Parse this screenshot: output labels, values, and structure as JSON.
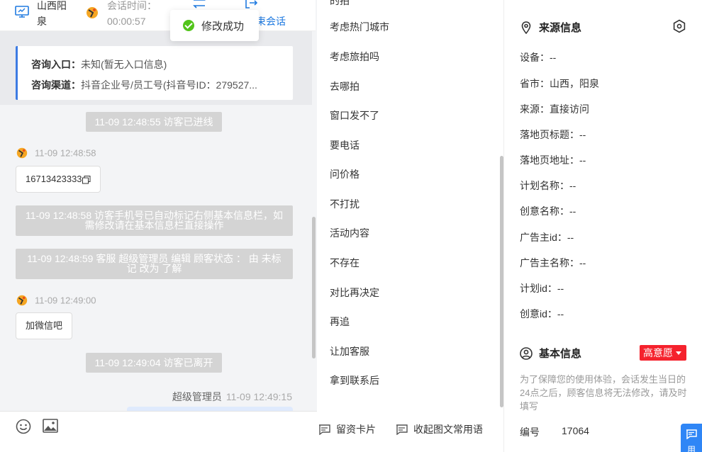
{
  "header": {
    "location": "山西阳泉",
    "session_time_label": "会话时间：",
    "session_time_value": "00:00:57",
    "end_session": "束会话"
  },
  "toast": {
    "message": "修改成功"
  },
  "info_card": {
    "entry_label": "咨询入口：",
    "entry_value": "未知(暂无入口信息)",
    "channel_label": "咨询渠道：",
    "channel_value": "抖音企业号/员工号(抖音号ID：279527..."
  },
  "messages": {
    "sys1": "11-09 12:48:55 访客已进线",
    "visitor1_time": "11-09 12:48:58",
    "visitor1_text": "16713423333",
    "sys2": "11-09 12:48:58 访客手机号已自动标记右侧基本信息栏，如需修改请在基本信息栏直接操作",
    "sys3": "11-09 12:48:59 客服 超级管理员 编辑 顾客状态 ： 由 未标记 改为 了解",
    "visitor2_time": "11-09 12:49:00",
    "visitor2_text": "加微信吧",
    "sys4": "11-09 12:49:04 访客已离开",
    "agent_name": "超级管理员",
    "agent_time": "11-09 12:49:15"
  },
  "quick_replies": {
    "items": [
      "考虑热门城市",
      "考虑旅拍吗",
      "去哪拍",
      "窗口发不了",
      "要电话",
      "问价格",
      "不打扰",
      "活动内容",
      "不存在",
      "对比再决定",
      "再追",
      "让加客服",
      "拿到联系后"
    ],
    "footer_card": "留资卡片",
    "footer_collapse": "收起图文常用语"
  },
  "source_info": {
    "title": "来源信息",
    "device": "设备：--",
    "province": "省市：山西，阳泉",
    "source": "来源：直接访问",
    "landing_title": "落地页标题：--",
    "landing_url": "落地页地址：--",
    "plan_name": "计划名称：--",
    "creative_name": "创意名称：--",
    "advertiser_id": "广告主id：--",
    "advertiser_name": "广告主名称：--",
    "plan_id": "计划id：--",
    "creative_id": "创意id：--"
  },
  "basic_info": {
    "title": "基本信息",
    "intent_badge": "高意愿",
    "notice": "为了保障您的使用体验，会话发生当日的24点之后，顾客信息将无法修改，请及时填写",
    "number_label": "编号",
    "number_value": "17064"
  },
  "colors": {
    "accent": "#1f7ae0",
    "badge": "#f5222d",
    "success": "#52c41a",
    "float": "#2f86f6"
  }
}
